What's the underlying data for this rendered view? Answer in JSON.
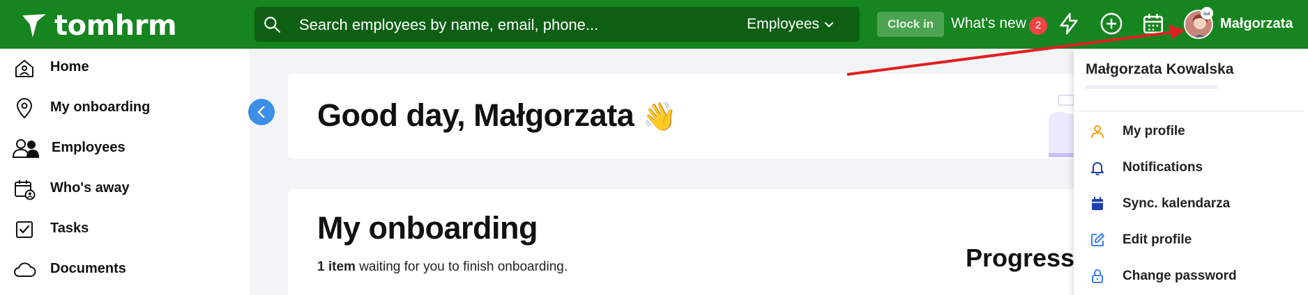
{
  "app": {
    "logo_text": "tomhrm"
  },
  "topbar": {
    "search_placeholder": "Search employees by name, email, phone...",
    "search_scope": "Employees",
    "clock_in_label": "Clock in",
    "whats_new_label": "What's new",
    "whats_new_count": "2",
    "user_name": "Małgorzata",
    "icons": [
      "search-icon",
      "chevron-down-icon",
      "lightning-icon",
      "plus-circle-icon",
      "calendar-icon"
    ]
  },
  "sidebar": {
    "items": [
      {
        "label": "Home",
        "icon": "home-icon"
      },
      {
        "label": "My onboarding",
        "icon": "map-pin-icon"
      },
      {
        "label": "Employees",
        "icon": "users-icon"
      },
      {
        "label": "Who's away",
        "icon": "calendar-user-icon"
      },
      {
        "label": "Tasks",
        "icon": "checkbox-icon"
      },
      {
        "label": "Documents",
        "icon": "cloud-icon"
      }
    ]
  },
  "main": {
    "greeting": "Good day, Małgorzata",
    "greeting_emoji": "👋",
    "onboarding": {
      "title": "My onboarding",
      "count_bold": "1 item",
      "count_rest": " waiting for you to finish onboarding."
    },
    "progress_title": "Progress"
  },
  "user_menu": {
    "full_name": "Małgorzata Kowalska",
    "items": [
      {
        "label": "My profile",
        "icon": "user-icon",
        "color": "#f59e0b"
      },
      {
        "label": "Notifications",
        "icon": "bell-icon",
        "color": "#1e40af"
      },
      {
        "label": "Sync. kalendarza",
        "icon": "calendar-icon",
        "color": "#1e40af"
      },
      {
        "label": "Edit profile",
        "icon": "edit-icon",
        "color": "#3b82f6"
      },
      {
        "label": "Change password",
        "icon": "lock-icon",
        "color": "#3b82f6"
      }
    ]
  },
  "colors": {
    "topbar": "#16841f",
    "search_bg": "#0e5f14",
    "accent_blue": "#3b8fe6",
    "badge_red": "#ef4444",
    "annotation_arrow": "#e02020"
  }
}
